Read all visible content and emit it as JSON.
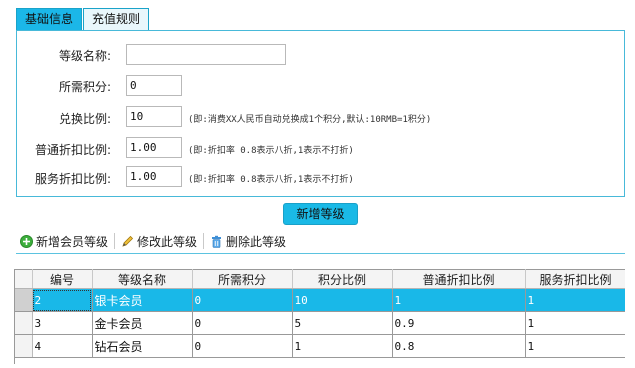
{
  "tabs": [
    {
      "label": "基础信息",
      "active": true
    },
    {
      "label": "充值规则",
      "active": false
    }
  ],
  "form": {
    "level_name": {
      "label": "等级名称:",
      "value": ""
    },
    "required_points": {
      "label": "所需积分:",
      "value": "0"
    },
    "exchange_ratio": {
      "label": "兑换比例:",
      "value": "10",
      "hint": "(即:消费XX人民币自动兑换成1个积分,默认:10RMB=1积分)"
    },
    "normal_discount": {
      "label": "普通折扣比例:",
      "value": "1.00",
      "hint": "(即:折扣率 0.8表示八折,1表示不打折)"
    },
    "service_discount": {
      "label": "服务折扣比例:",
      "value": "1.00",
      "hint": "(即:折扣率 0.8表示八折,1表示不打折)"
    }
  },
  "add_level_button": "新增等级",
  "toolbar": {
    "add": "新增会员等级",
    "edit": "修改此等级",
    "delete": "删除此等级"
  },
  "grid": {
    "columns": [
      "编号",
      "等级名称",
      "所需积分",
      "积分比例",
      "普通折扣比例",
      "服务折扣比例"
    ],
    "rows": [
      [
        "2",
        "银卡会员",
        "0",
        "10",
        "1",
        "1"
      ],
      [
        "3",
        "金卡会员",
        "0",
        "5",
        "0.9",
        "1"
      ],
      [
        "4",
        "钻石会员",
        "0",
        "1",
        "0.8",
        "1"
      ]
    ],
    "selected_row": 0
  },
  "colors": {
    "accent": "#1bb7e8",
    "border": "#48b9d9",
    "selected": "#19b8e8"
  }
}
